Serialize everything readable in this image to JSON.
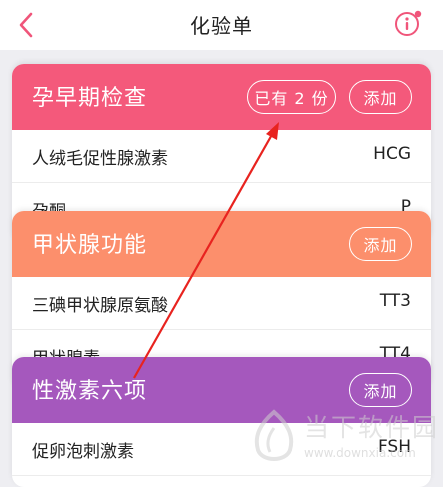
{
  "header": {
    "title": "化验单"
  },
  "colors": {
    "accent": "#f0557a",
    "card1": "#f4597b",
    "card2": "#fc8f6c",
    "card3": "#a558bd",
    "annotation_arrow": "#e8231f"
  },
  "cards": [
    {
      "title": "孕早期检查",
      "count_label": "已有 2 份",
      "add_label": "添加",
      "rows": [
        {
          "name": "人绒毛促性腺激素",
          "code": "HCG"
        },
        {
          "name": "孕酮",
          "code": "P"
        }
      ]
    },
    {
      "title": "甲状腺功能",
      "add_label": "添加",
      "rows": [
        {
          "name": "三碘甲状腺原氨酸",
          "code": "TT3"
        },
        {
          "name": "甲状腺素",
          "code": "TT4"
        }
      ]
    },
    {
      "title": "性激素六项",
      "add_label": "添加",
      "rows": [
        {
          "name": "促卵泡刺激素",
          "code": "FSH"
        }
      ]
    }
  ],
  "watermark": {
    "name": "当下软件园",
    "url": "www.downxia.com"
  }
}
